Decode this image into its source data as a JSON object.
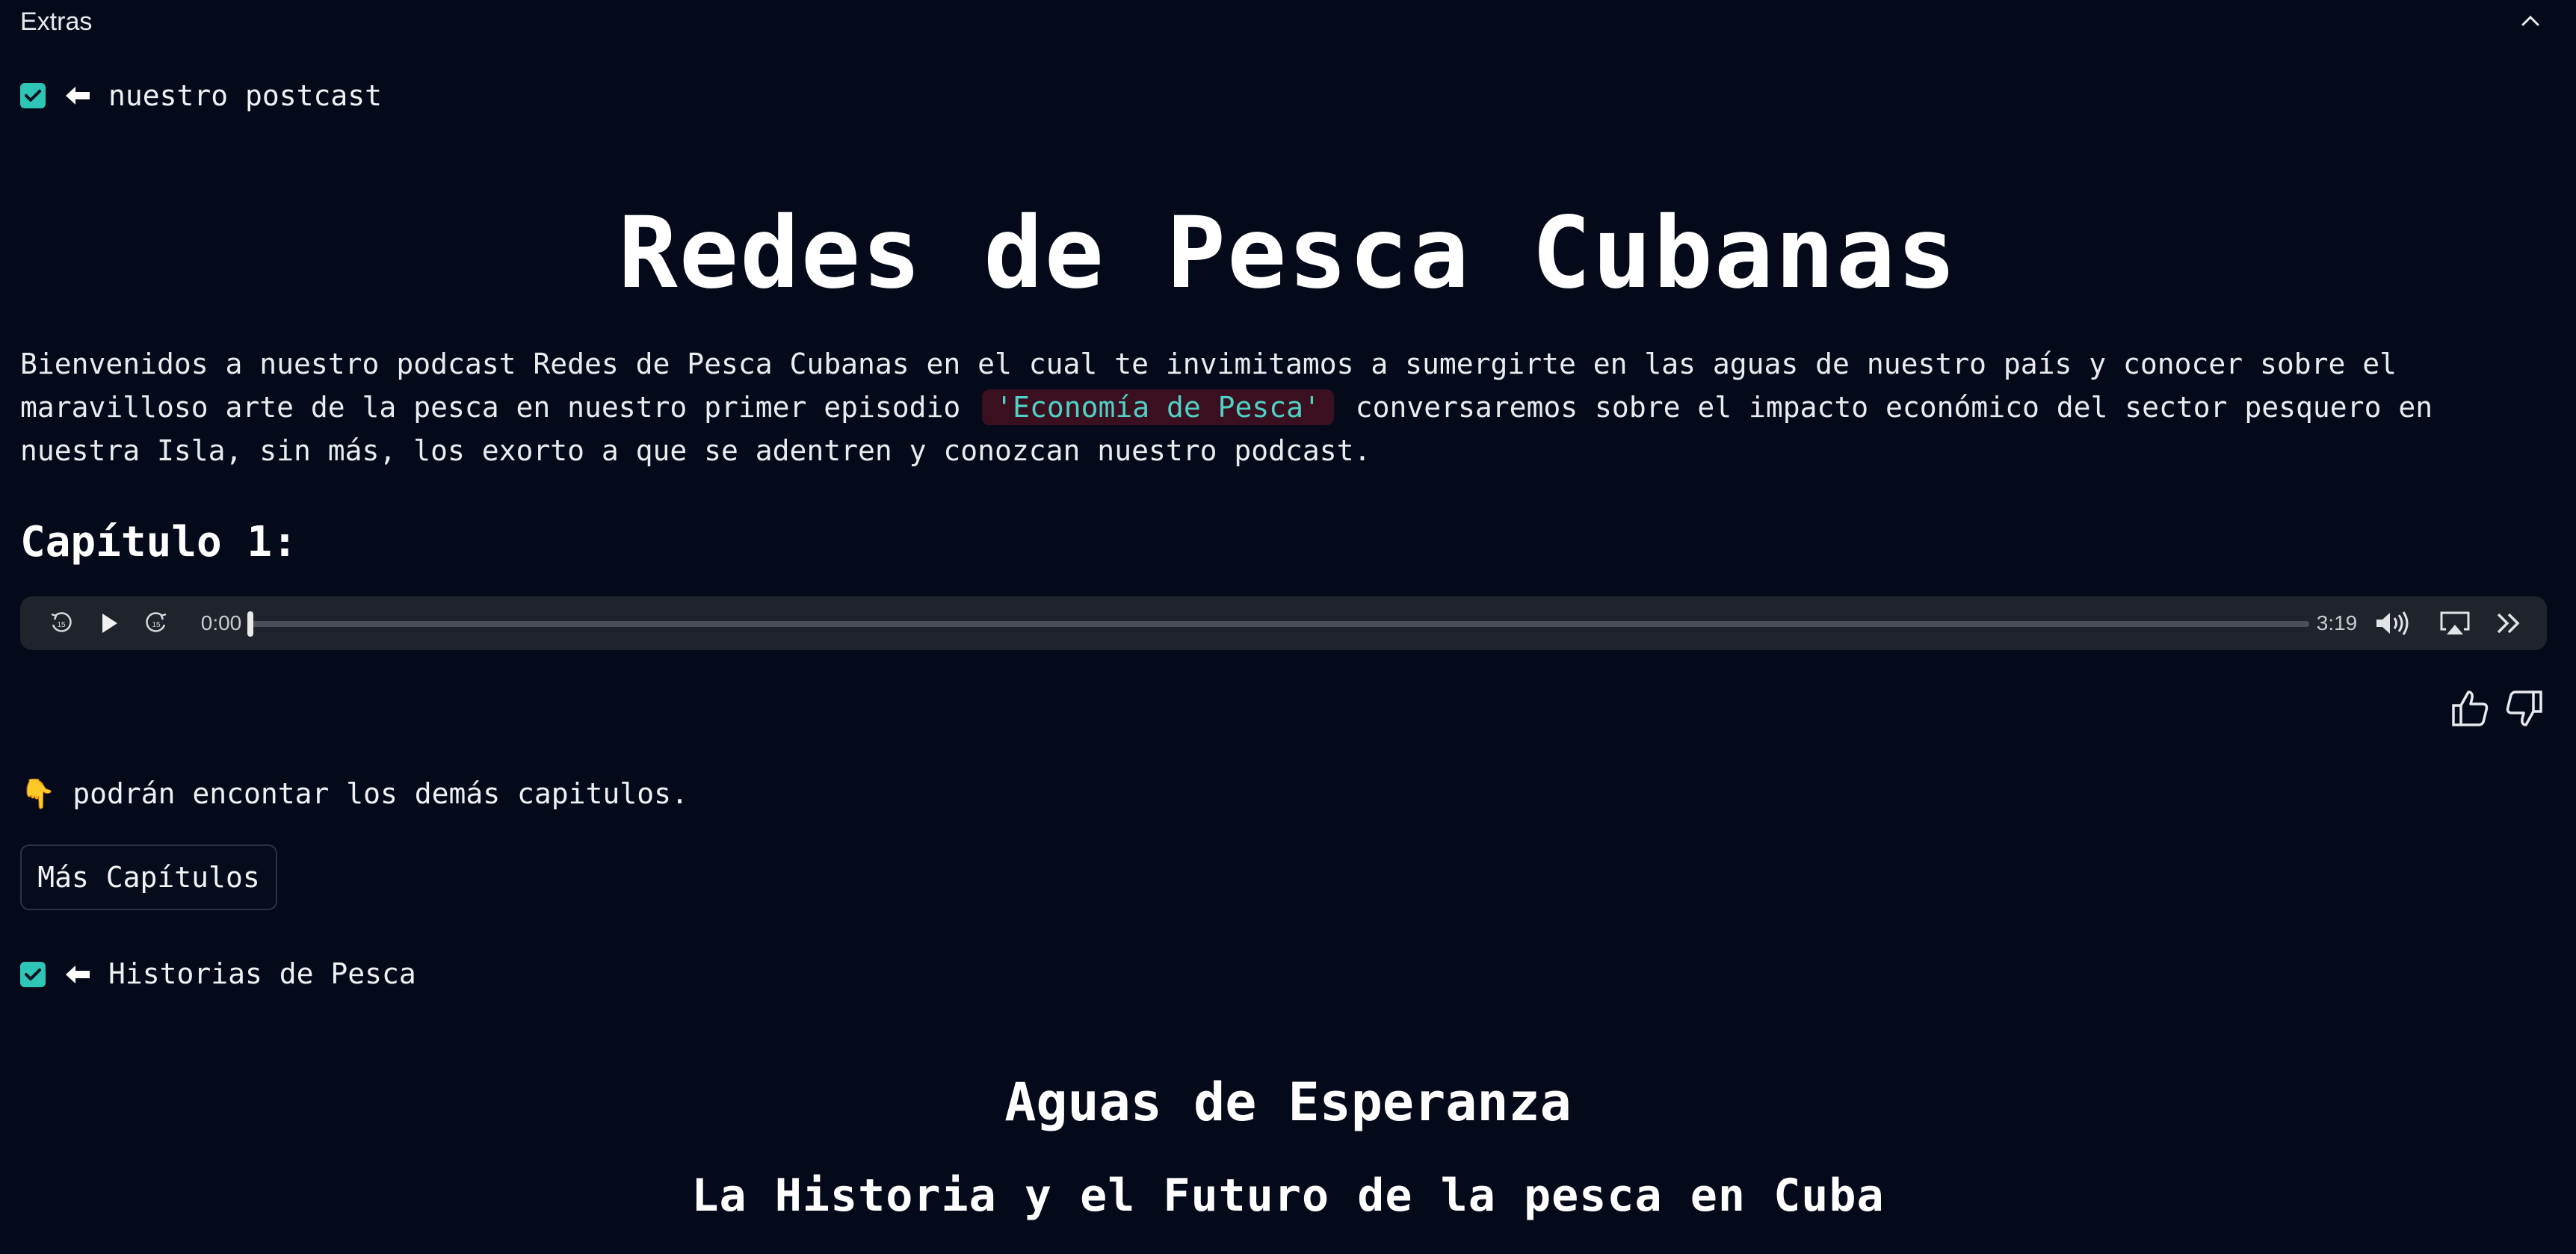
{
  "extras": {
    "title": "Extras",
    "collapse_icon": "chevron-up-icon"
  },
  "toggle_podcast": {
    "checked": true,
    "arrow": "🠸",
    "label": "nuestro postcast"
  },
  "podcast": {
    "title": "Redes de Pesca Cubanas",
    "intro_before": "Bienvenidos a nuestro podcast Redes de Pesca Cubanas en el cual te invimitamos a sumergirte en las aguas de nuestro país y conocer sobre el maravilloso arte de la pesca en nuestro primer episodio",
    "intro_code": "'Economía de Pesca'",
    "intro_after": "conversaremos sobre el impacto económico del sector pesquero en nuestra Isla, sin más, los exorto a que se adentren y conozcan nuestro podcast.",
    "chapter_title": "Capítulo 1:"
  },
  "audio_player": {
    "current_time": "0:00",
    "duration": "3:19",
    "progress": 0.0,
    "icons": [
      "skip-back-15-icon",
      "play-icon",
      "skip-forward-15-icon",
      "volume-icon",
      "airplay-icon",
      "more-chevrons-icon"
    ]
  },
  "feedback": {
    "thumbs_up_icon": "thumbs-up-icon",
    "thumbs_down_icon": "thumbs-down-icon"
  },
  "more": {
    "emoji": "👇",
    "text": "podrán encontar los demás capitulos.",
    "button_label": "Más Capítulos"
  },
  "toggle_historias": {
    "checked": true,
    "arrow": "🠸",
    "label": "Historias de Pesca"
  },
  "story": {
    "title": "Aguas de Esperanza",
    "subtitle": "La Historia y el Futuro de la pesca en Cuba"
  },
  "colors": {
    "background": "#050a1a",
    "accent": "#2ec4b6",
    "code_text": "#4fd1c5",
    "code_bg": "#3a1020",
    "player_bg": "#1f232c"
  }
}
